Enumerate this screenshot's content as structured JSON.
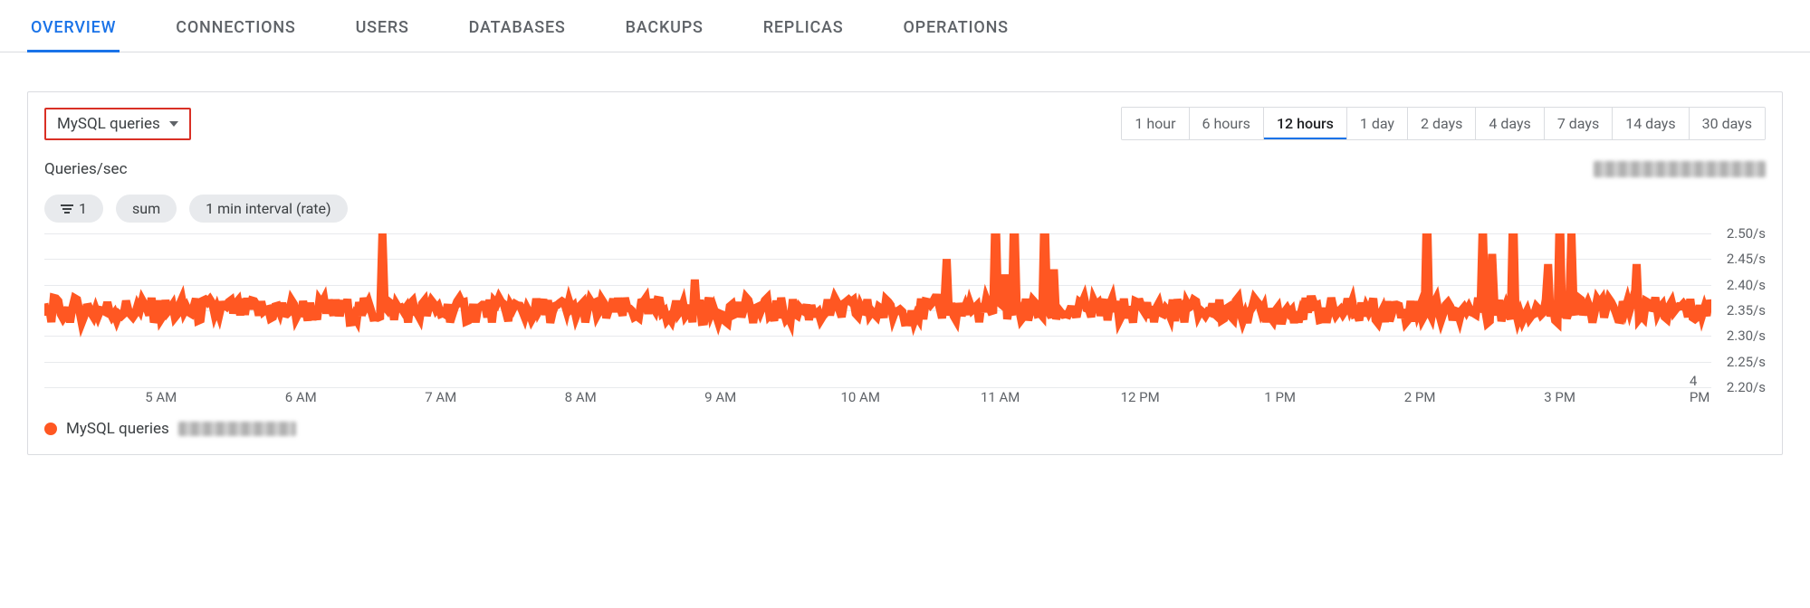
{
  "tabs": {
    "items": [
      "OVERVIEW",
      "CONNECTIONS",
      "USERS",
      "DATABASES",
      "BACKUPS",
      "REPLICAS",
      "OPERATIONS"
    ],
    "active_index": 0
  },
  "metric_selector": {
    "label": "MySQL queries"
  },
  "time_ranges": {
    "items": [
      "1 hour",
      "6 hours",
      "12 hours",
      "1 day",
      "2 days",
      "4 days",
      "7 days",
      "14 days",
      "30 days"
    ],
    "active_index": 2
  },
  "chart_header": {
    "y_axis_title": "Queries/sec"
  },
  "chips": {
    "filter_count": "1",
    "agg": "sum",
    "interval": "1 min interval (rate)"
  },
  "legend": {
    "series_name": "MySQL queries",
    "color": "#ff5722"
  },
  "chart_data": {
    "type": "line",
    "title": "Queries/sec",
    "xlabel": "",
    "ylabel": "Queries/sec",
    "ylim": [
      2.2,
      2.5
    ],
    "x_tick_labels": [
      "5 AM",
      "6 AM",
      "7 AM",
      "8 AM",
      "9 AM",
      "10 AM",
      "11 AM",
      "12 PM",
      "1 PM",
      "2 PM",
      "3 PM",
      "4 PM"
    ],
    "y_tick_labels": [
      "2.50/s",
      "2.45/s",
      "2.40/s",
      "2.35/s",
      "2.30/s",
      "2.25/s",
      "2.20/s"
    ],
    "x_start_minute": 250,
    "x_end_minute": 965,
    "series": [
      {
        "name": "MySQL queries",
        "color": "#ff5722",
        "baseline": 2.35,
        "jitter": 0.025,
        "n_points": 715,
        "spikes": [
          {
            "minute": 395,
            "value": 2.5
          },
          {
            "minute": 529,
            "value": 2.41
          },
          {
            "minute": 637,
            "value": 2.45
          },
          {
            "minute": 658,
            "value": 2.55
          },
          {
            "minute": 662,
            "value": 2.42
          },
          {
            "minute": 666,
            "value": 2.55
          },
          {
            "minute": 679,
            "value": 2.55
          },
          {
            "minute": 683,
            "value": 2.43
          },
          {
            "minute": 843,
            "value": 2.55
          },
          {
            "minute": 867,
            "value": 2.52
          },
          {
            "minute": 871,
            "value": 2.46
          },
          {
            "minute": 880,
            "value": 2.55
          },
          {
            "minute": 895,
            "value": 2.44
          },
          {
            "minute": 900,
            "value": 2.55
          },
          {
            "minute": 905,
            "value": 2.5
          },
          {
            "minute": 933,
            "value": 2.44
          }
        ]
      }
    ]
  }
}
